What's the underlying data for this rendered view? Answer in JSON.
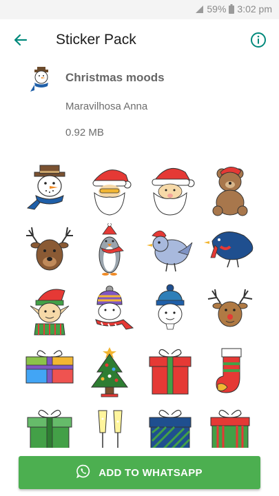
{
  "status_bar": {
    "battery": "59%",
    "time": "3:02 pm"
  },
  "app_bar": {
    "title": "Sticker Pack",
    "back_icon": "arrow-left-icon",
    "info_icon": "info-icon"
  },
  "pack": {
    "name": "Christmas moods",
    "publisher": "Maravilhosa Anna",
    "size": "0.92 MB",
    "tray_icon": "snowman-icon"
  },
  "stickers": [
    "snowman",
    "santa-face",
    "santa-face-red-hat",
    "teddy-bear",
    "reindeer-face",
    "penguin",
    "blue-bird",
    "blue-bird-scarf",
    "elf",
    "kid-beanie-scarf",
    "kid-blue-beanie",
    "reindeer",
    "gift-box-colorful",
    "christmas-tree",
    "gift-box-red",
    "christmas-stocking",
    "gift-box-green",
    "champagne-glasses",
    "gift-box-blue-striped",
    "gift-box-red-green"
  ],
  "action": {
    "label": "ADD TO WHATSAPP",
    "icon": "whatsapp-icon"
  },
  "colors": {
    "accent": "#00897b",
    "button": "#4caf50"
  }
}
